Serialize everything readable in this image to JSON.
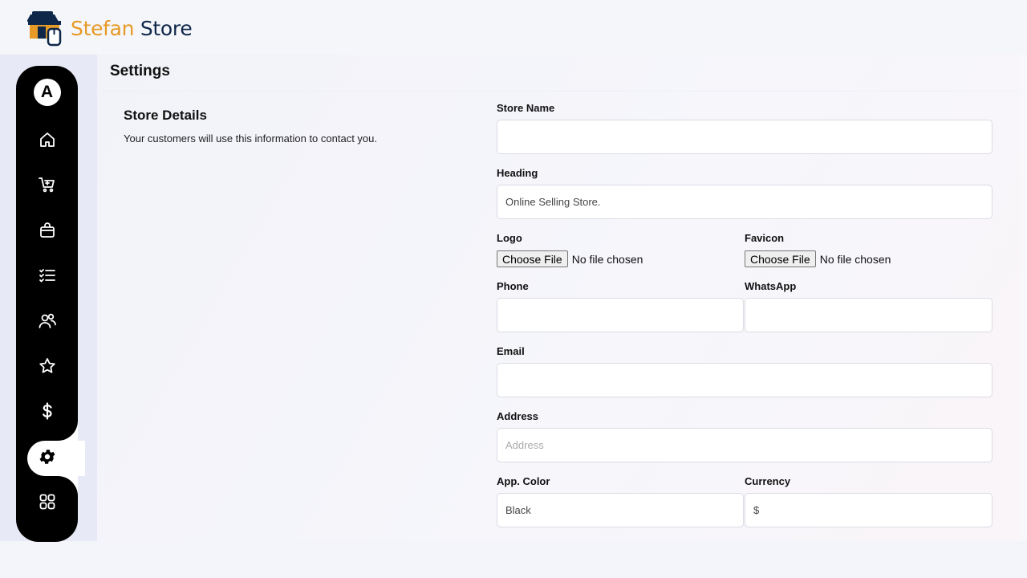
{
  "brand": {
    "name_part1": "Stefan",
    "name_part2": " Store",
    "accent": "#e79a26",
    "dark": "#0f2749"
  },
  "sidebar": {
    "avatar_letter": "A",
    "items": [
      {
        "icon": "home-icon"
      },
      {
        "icon": "cart-icon"
      },
      {
        "icon": "bag-icon"
      },
      {
        "icon": "checklist-icon"
      },
      {
        "icon": "users-icon"
      },
      {
        "icon": "star-icon"
      },
      {
        "icon": "dollar-icon"
      },
      {
        "icon": "gear-icon",
        "active": true
      },
      {
        "icon": "grid-icon"
      }
    ]
  },
  "page": {
    "title": "Settings"
  },
  "section": {
    "title": "Store Details",
    "description": "Your customers will use this information to contact you."
  },
  "form": {
    "store_name": {
      "label": "Store Name",
      "value": "",
      "placeholder": ""
    },
    "heading": {
      "label": "Heading",
      "value": "Online Selling Store.",
      "placeholder": ""
    },
    "logo": {
      "label": "Logo",
      "button": "Choose File",
      "status": "No file chosen"
    },
    "favicon": {
      "label": "Favicon",
      "button": "Choose File",
      "status": "No file chosen"
    },
    "phone": {
      "label": "Phone",
      "value": "",
      "placeholder": ""
    },
    "whatsapp": {
      "label": "WhatsApp",
      "value": "",
      "placeholder": ""
    },
    "email": {
      "label": "Email",
      "value": "",
      "placeholder": ""
    },
    "address": {
      "label": "Address",
      "value": "",
      "placeholder": "Address"
    },
    "app_color": {
      "label": "App. Color",
      "value": "Black",
      "placeholder": ""
    },
    "currency": {
      "label": "Currency",
      "value": "$",
      "placeholder": ""
    }
  }
}
